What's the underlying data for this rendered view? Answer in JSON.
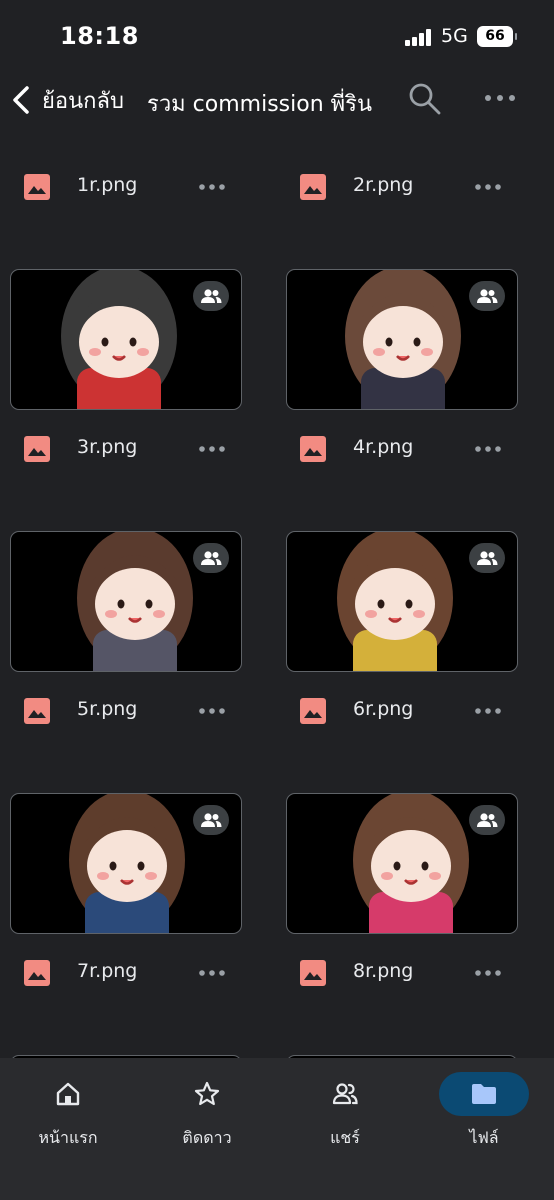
{
  "status_bar": {
    "time": "18:18",
    "network": "5G",
    "battery": "66"
  },
  "header": {
    "back_label": "ย้อนกลับ",
    "title": "รวม commission พี่ริน",
    "icons": [
      "chevron-left-icon",
      "search-icon",
      "more-vert-icon"
    ]
  },
  "files": [
    {
      "name": "1r.png",
      "shared": true
    },
    {
      "name": "2r.png",
      "shared": true
    },
    {
      "name": "3r.png",
      "shared": true
    },
    {
      "name": "4r.png",
      "shared": true
    },
    {
      "name": "5r.png",
      "shared": true
    },
    {
      "name": "6r.png",
      "shared": true
    },
    {
      "name": "7r.png",
      "shared": true
    },
    {
      "name": "8r.png",
      "shared": true
    }
  ],
  "bottom_nav": [
    {
      "label": "หน้าแรก",
      "icon": "home-icon",
      "active": false
    },
    {
      "label": "ติดดาว",
      "icon": "star-icon",
      "active": false
    },
    {
      "label": "แชร์",
      "icon": "people-icon",
      "active": false
    },
    {
      "label": "ไฟล์",
      "icon": "folder-icon",
      "active": true
    }
  ],
  "colors": {
    "background": "#202124",
    "file_icon": "#f28b82",
    "active_nav": "#0b4a73",
    "active_icon": "#a8c7fa"
  }
}
